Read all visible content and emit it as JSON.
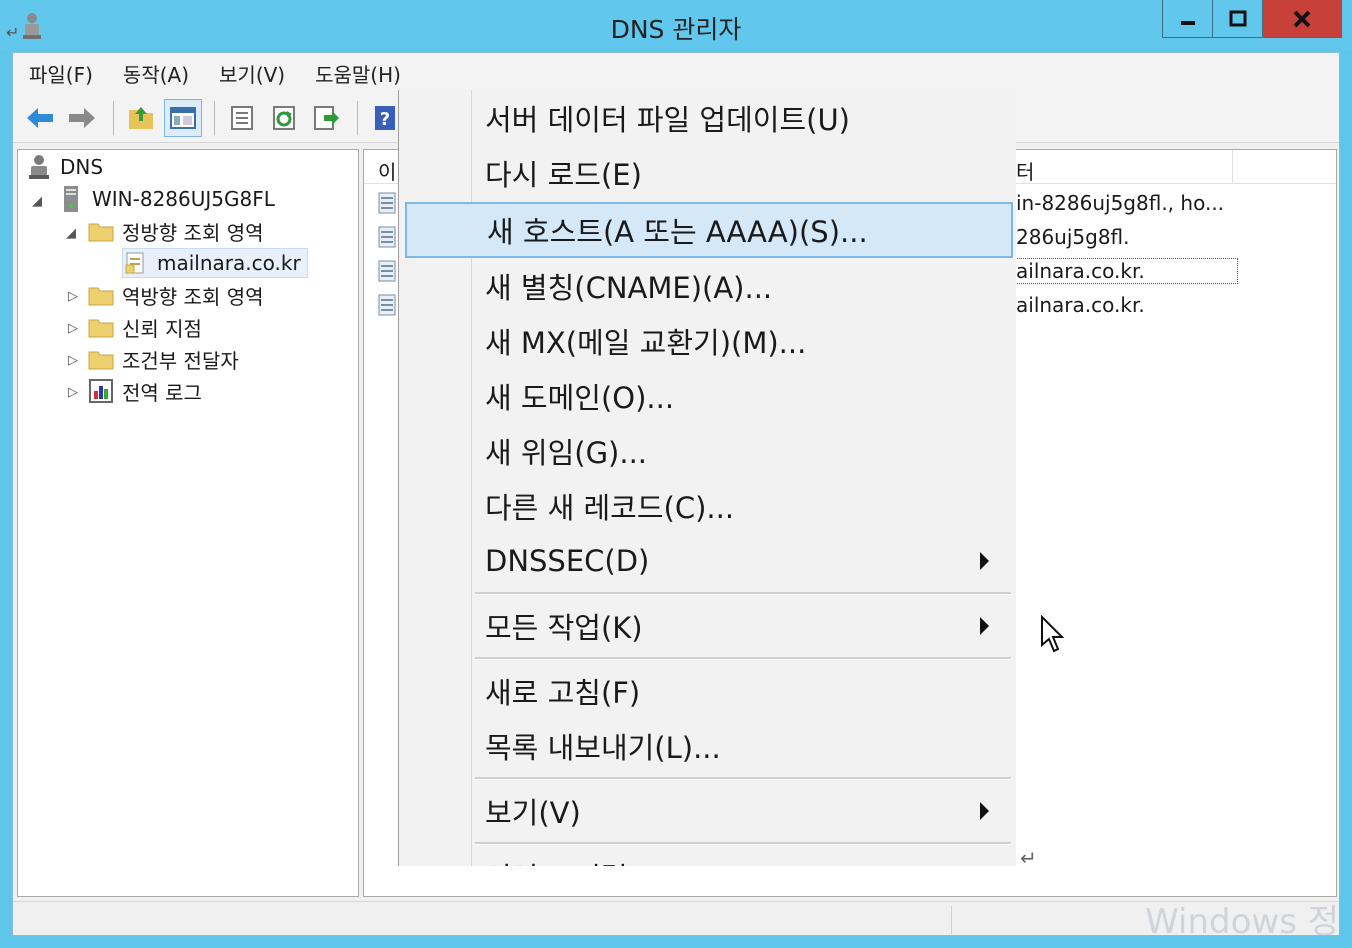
{
  "window": {
    "title": "DNS 관리자",
    "min_glyph": "▬",
    "max_glyph": "■",
    "close_glyph": "X"
  },
  "menubar": {
    "items": [
      "파일(F)",
      "동작(A)",
      "보기(V)",
      "도움말(H)"
    ]
  },
  "toolbar": {
    "icons": [
      "back-arrow-icon",
      "forward-arrow-icon",
      "up-folder-icon",
      "show-hide-console-tree-icon",
      "properties-icon",
      "refresh-icon",
      "export-list-icon",
      "help-icon"
    ],
    "help_glyph": "?"
  },
  "tree": {
    "root": "DNS",
    "server": "WIN-8286UJ5G8FL",
    "forward_zones": "정방향 조회 영역",
    "zone": "mailnara.co.kr",
    "reverse_zones": "역방향 조회 영역",
    "trust_points": "신뢰 지점",
    "conditional_forwarders": "조건부 전달자",
    "global_logs": "전역 로그",
    "expanded_glyph": "◢",
    "collapsed_glyph": "▷"
  },
  "detail": {
    "header_left": "이",
    "header_right": "터",
    "rows": [
      "in-8286uj5g8fl., ho...",
      "286uj5g8fl.",
      "ailnara.co.kr.",
      "ailnara.co.kr."
    ]
  },
  "context_menu": {
    "items": [
      {
        "label": "서버 데이터 파일 업데이트(U)"
      },
      {
        "label": "다시 로드(E)"
      },
      {
        "label": "새 호스트(A 또는 AAAA)(S)..."
      },
      {
        "label": "새 별칭(CNAME)(A)..."
      },
      {
        "label": "새 MX(메일 교환기)(M)..."
      },
      {
        "label": "새 도메인(O)..."
      },
      {
        "label": "새 위임(G)..."
      },
      {
        "label": "다른 새 레코드(C)..."
      },
      {
        "label": "DNSSEC(D)"
      },
      {
        "label": "모든 작업(K)"
      },
      {
        "label": "새로 고침(F)"
      },
      {
        "label": "목록 내보내기(L)..."
      },
      {
        "label": "보기(V)"
      },
      {
        "label": "이어드 정렬"
      }
    ],
    "highlighted": "새 호스트(A 또는 AAAA)(S)..."
  },
  "marks": {
    "return_glyph": "↵"
  },
  "watermark": "Windows 정"
}
